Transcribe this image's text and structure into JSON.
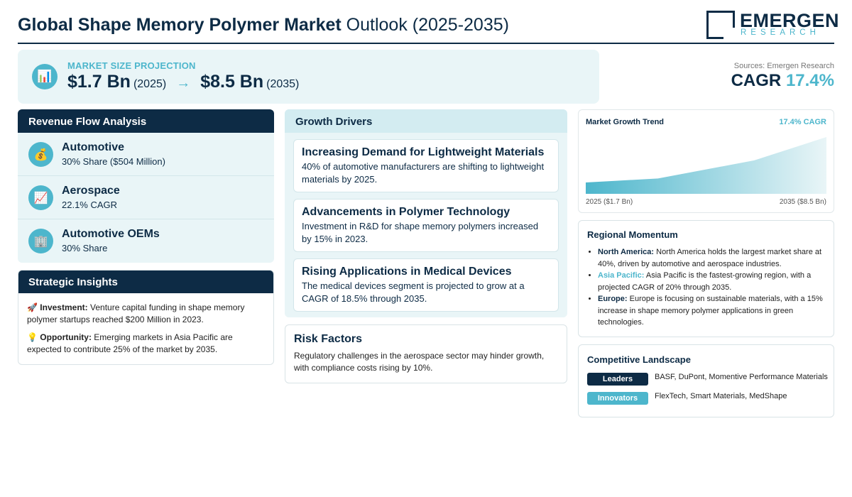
{
  "header": {
    "title_bold": "Global Shape Memory Polymer Market",
    "title_rest": "Outlook (2025-2035)",
    "logo_name": "EMERGEN",
    "logo_sub": "RESEARCH"
  },
  "projection": {
    "label": "MARKET SIZE PROJECTION",
    "icon": "bar-chart-icon",
    "start_value": "$1.7 Bn",
    "start_year": "(2025)",
    "arrow": "→",
    "end_value": "$8.5 Bn",
    "end_year": "(2035)"
  },
  "summary": {
    "sources": "Sources: Emergen Research",
    "cagr_label": "CAGR",
    "cagr_value": "17.4%"
  },
  "revenue": {
    "title": "Revenue Flow Analysis",
    "items": [
      {
        "icon": "money-bag-icon",
        "glyph": "💰",
        "title": "Automotive",
        "sub": "30% Share ($504 Million)"
      },
      {
        "icon": "chart-up-icon",
        "glyph": "📈",
        "title": "Aerospace",
        "sub": "22.1% CAGR"
      },
      {
        "icon": "building-icon",
        "glyph": "🏢",
        "title": "Automotive OEMs",
        "sub": "30% Share"
      }
    ]
  },
  "strategic": {
    "title": "Strategic Insights",
    "items": [
      {
        "icon": "rocket-icon",
        "glyph": "🚀",
        "label": "Investment:",
        "text": "Venture capital funding in shape memory polymer startups reached $200 Million in 2023."
      },
      {
        "icon": "lightbulb-icon",
        "glyph": "💡",
        "label": "Opportunity:",
        "text": "Emerging markets in Asia Pacific are expected to contribute 25% of the market by 2035."
      }
    ]
  },
  "drivers": {
    "title": "Growth Drivers",
    "items": [
      {
        "title": "Increasing Demand for Lightweight Materials",
        "text": "40% of automotive manufacturers are shifting to lightweight materials by 2025."
      },
      {
        "title": "Advancements in Polymer Technology",
        "text": "Investment in R&D for shape memory polymers increased by 15% in 2023."
      },
      {
        "title": "Rising Applications in Medical Devices",
        "text": "The medical devices segment is projected to grow at a CAGR of 18.5% through 2035."
      }
    ]
  },
  "risk": {
    "title": "Risk Factors",
    "text": "Regulatory challenges in the aerospace sector may hinder growth, with compliance costs rising by 10%."
  },
  "trend": {
    "title": "Market Growth Trend",
    "cagr": "17.4% CAGR",
    "start_label": "2025 ($1.7 Bn)",
    "end_label": "2035 ($8.5 Bn)",
    "color_dark": "#4db6cc",
    "color_light": "#e9f5f7"
  },
  "chart_data": {
    "type": "area",
    "x": [
      2025,
      2028,
      2032,
      2035
    ],
    "values": [
      1.7,
      2.3,
      5.0,
      8.5
    ],
    "xlim": [
      2025,
      2035
    ],
    "ylim": [
      0,
      8.5
    ]
  },
  "regional": {
    "title": "Regional Momentum",
    "items": [
      {
        "name": "North America:",
        "teal": false,
        "text": "North America holds the largest market share at 40%, driven by automotive and aerospace industries."
      },
      {
        "name": "Asia Pacific:",
        "teal": true,
        "text": "Asia Pacific is the fastest-growing region, with a projected CAGR of 20% through 2035."
      },
      {
        "name": "Europe:",
        "teal": false,
        "text": "Europe is focusing on sustainable materials, with a 15% increase in shape memory polymer applications in green technologies."
      }
    ]
  },
  "competitive": {
    "title": "Competitive Landscape",
    "rows": [
      {
        "pill": "Leaders",
        "text": "BASF, DuPont, Momentive Performance Materials"
      },
      {
        "pill": "Innovators",
        "text": "FlexTech, Smart Materials, MedShape"
      }
    ]
  }
}
